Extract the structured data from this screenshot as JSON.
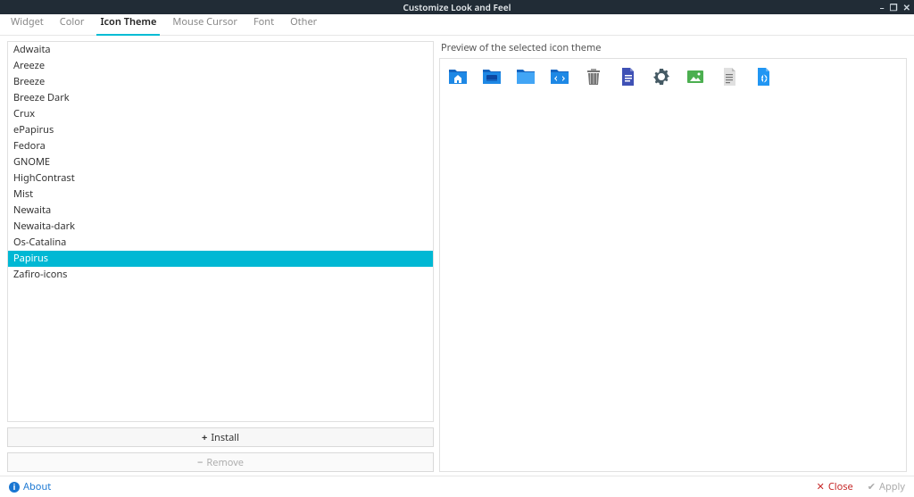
{
  "window": {
    "title": "Customize Look and Feel",
    "minimize_icon": "minimize-icon",
    "restore_icon": "restore-icon",
    "close_icon": "close-icon"
  },
  "tabs": [
    {
      "label": "Widget",
      "active": false
    },
    {
      "label": "Color",
      "active": false
    },
    {
      "label": "Icon Theme",
      "active": true
    },
    {
      "label": "Mouse Cursor",
      "active": false
    },
    {
      "label": "Font",
      "active": false
    },
    {
      "label": "Other",
      "active": false
    }
  ],
  "themes": [
    {
      "name": "Adwaita",
      "selected": false
    },
    {
      "name": "Areeze",
      "selected": false
    },
    {
      "name": "Breeze",
      "selected": false
    },
    {
      "name": "Breeze Dark",
      "selected": false
    },
    {
      "name": "Crux",
      "selected": false
    },
    {
      "name": "ePapirus",
      "selected": false
    },
    {
      "name": "Fedora",
      "selected": false
    },
    {
      "name": "GNOME",
      "selected": false
    },
    {
      "name": "HighContrast",
      "selected": false
    },
    {
      "name": "Mist",
      "selected": false
    },
    {
      "name": "Newaita",
      "selected": false
    },
    {
      "name": "Newaita-dark",
      "selected": false
    },
    {
      "name": "Os-Catalina",
      "selected": false
    },
    {
      "name": "Papirus",
      "selected": true
    },
    {
      "name": "Zafiro-icons",
      "selected": false
    }
  ],
  "buttons": {
    "install": "Install",
    "remove": "Remove"
  },
  "preview": {
    "label": "Preview of the selected icon theme",
    "icons": [
      "user-home-folder-icon",
      "desktop-folder-icon",
      "folder-icon",
      "code-folder-icon",
      "trash-icon",
      "document-icon",
      "settings-gear-icon",
      "image-icon",
      "text-file-icon",
      "html-globe-icon"
    ]
  },
  "footer": {
    "about": "About",
    "close": "Close",
    "apply": "Apply"
  },
  "colors": {
    "accent": "#00b8d4",
    "folder_blue": "#1e88e5",
    "folder_tab": "#1565c0",
    "doc_blue": "#3f51b5",
    "gear": "#455a64",
    "image_green": "#4caf50",
    "html_blue": "#2196f3",
    "trash_gray": "#757575"
  }
}
